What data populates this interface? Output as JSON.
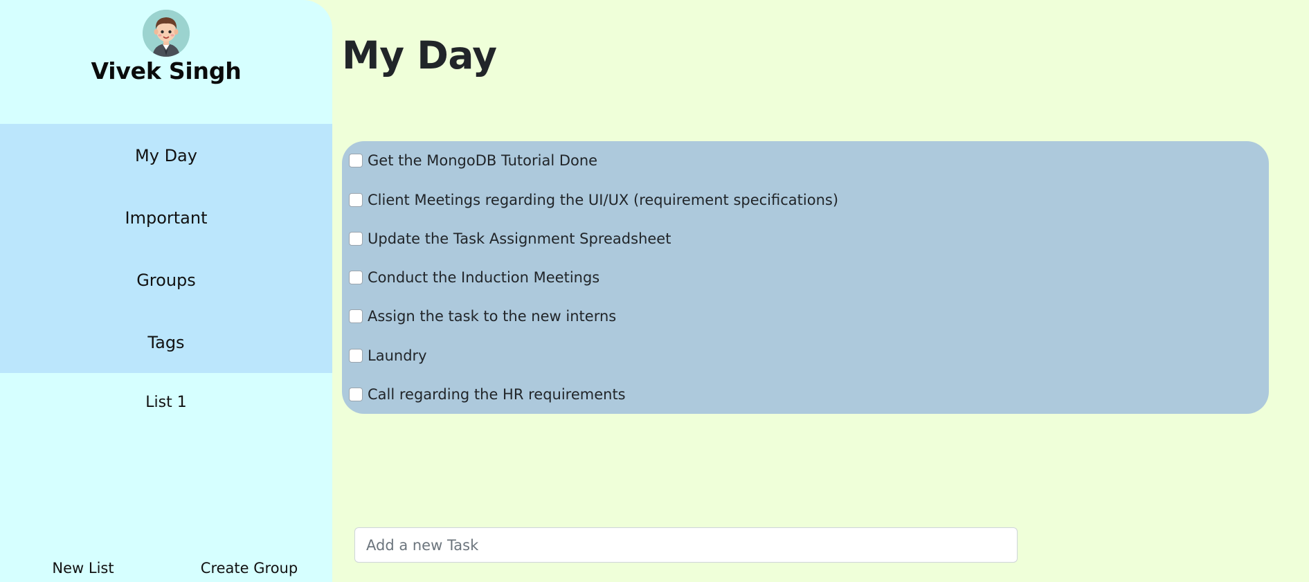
{
  "profile": {
    "name": "Vivek Singh",
    "avatar_icon": "boy-avatar-icon"
  },
  "nav": {
    "items": [
      {
        "label": "My Day"
      },
      {
        "label": "Important"
      },
      {
        "label": "Groups"
      },
      {
        "label": "Tags"
      }
    ]
  },
  "lists": [
    {
      "label": "List 1"
    }
  ],
  "footer": {
    "new_list": "New List",
    "create_group": "Create Group"
  },
  "main": {
    "title": "My Day",
    "tasks": [
      {
        "label": "Get the MongoDB Tutorial Done",
        "checked": false
      },
      {
        "label": "Client Meetings regarding the UI/UX (requirement specifications)",
        "checked": false
      },
      {
        "label": "Update the Task Assignment Spreadsheet",
        "checked": false
      },
      {
        "label": "Conduct the Induction Meetings",
        "checked": false
      },
      {
        "label": "Assign the task to the new interns",
        "checked": false
      },
      {
        "label": "Laundry",
        "checked": false
      },
      {
        "label": "Call regarding the HR requirements",
        "checked": false
      }
    ],
    "new_task": {
      "placeholder": "Add a new Task",
      "value": ""
    }
  },
  "colors": {
    "page_bg": "#efffd9",
    "sidebar_bg": "#d6ffff",
    "nav_bg": "#bbe6fc",
    "task_panel_bg": "#adc9dc"
  }
}
